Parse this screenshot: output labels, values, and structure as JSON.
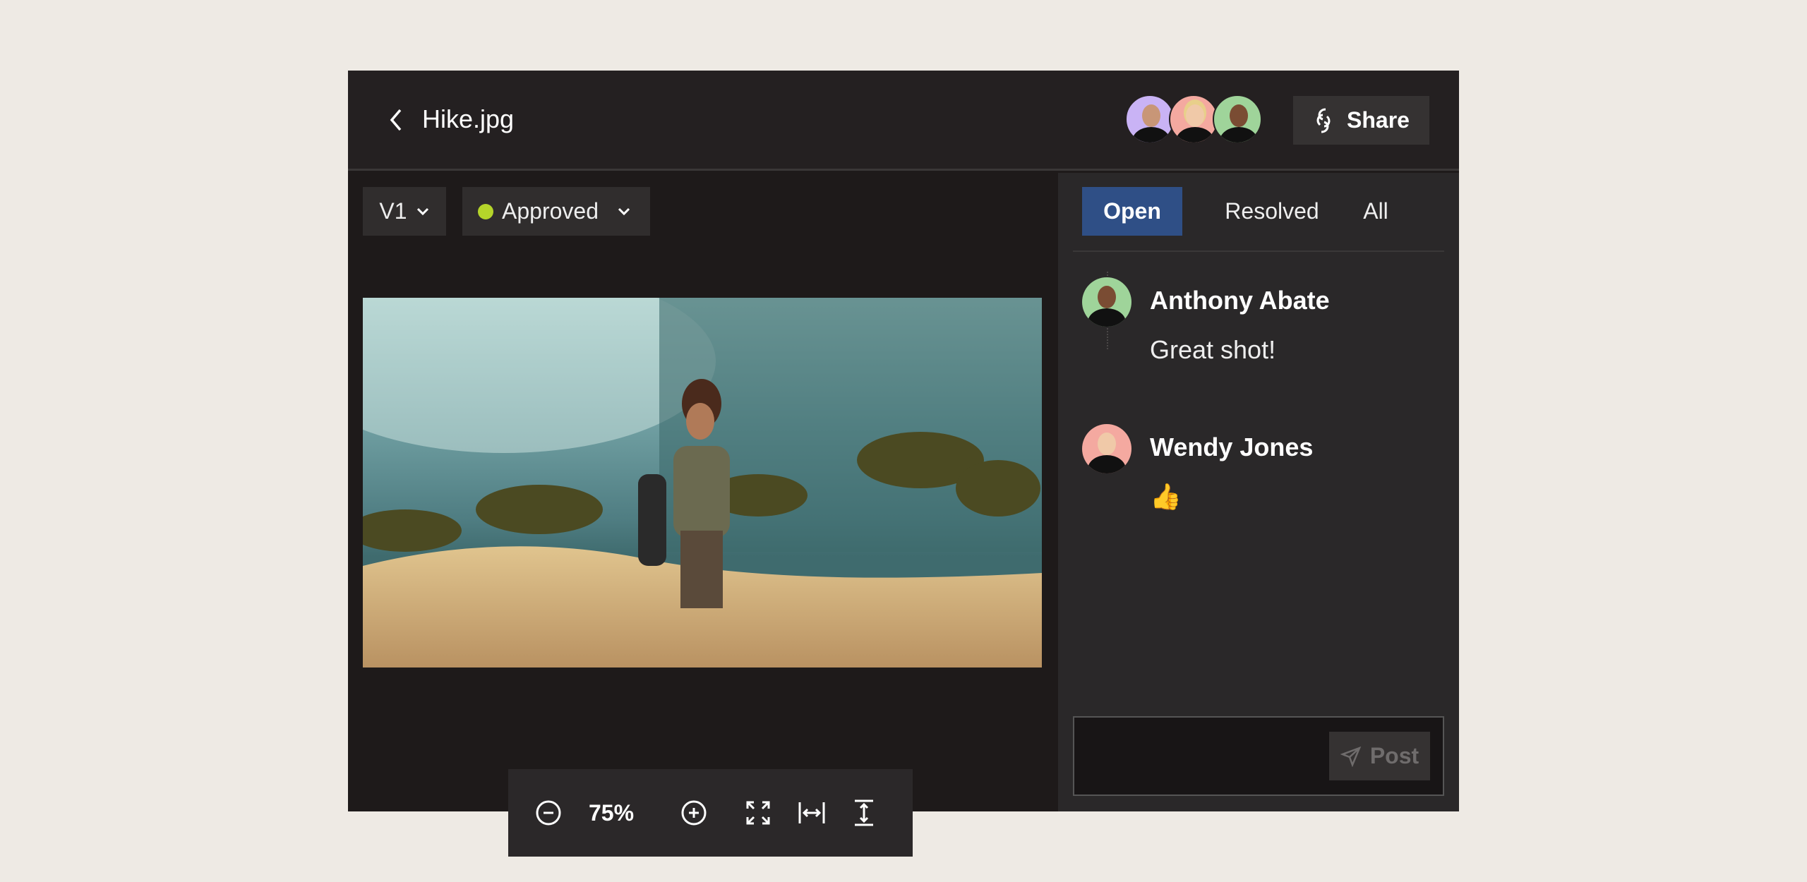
{
  "header": {
    "title": "Hike.jpg",
    "share_label": "Share",
    "collaborators": [
      {
        "name": "collaborator-1",
        "bg": "#c9b3f5"
      },
      {
        "name": "Wendy Jones",
        "bg": "#f4a9a0"
      },
      {
        "name": "Anthony Abate",
        "bg": "#9fd49a"
      }
    ]
  },
  "toolbar": {
    "version": "V1",
    "status": "Approved",
    "status_color": "#b5d52a"
  },
  "zoom": {
    "level": "75%"
  },
  "comments_panel": {
    "tabs": [
      {
        "label": "Open",
        "active": true
      },
      {
        "label": "Resolved",
        "active": false
      },
      {
        "label": "All",
        "active": false
      }
    ],
    "comments": [
      {
        "author": "Anthony Abate",
        "text": "Great shot!"
      },
      {
        "author": "Wendy Jones",
        "text": "👍"
      }
    ],
    "input_placeholder": "",
    "post_label": "Post"
  }
}
